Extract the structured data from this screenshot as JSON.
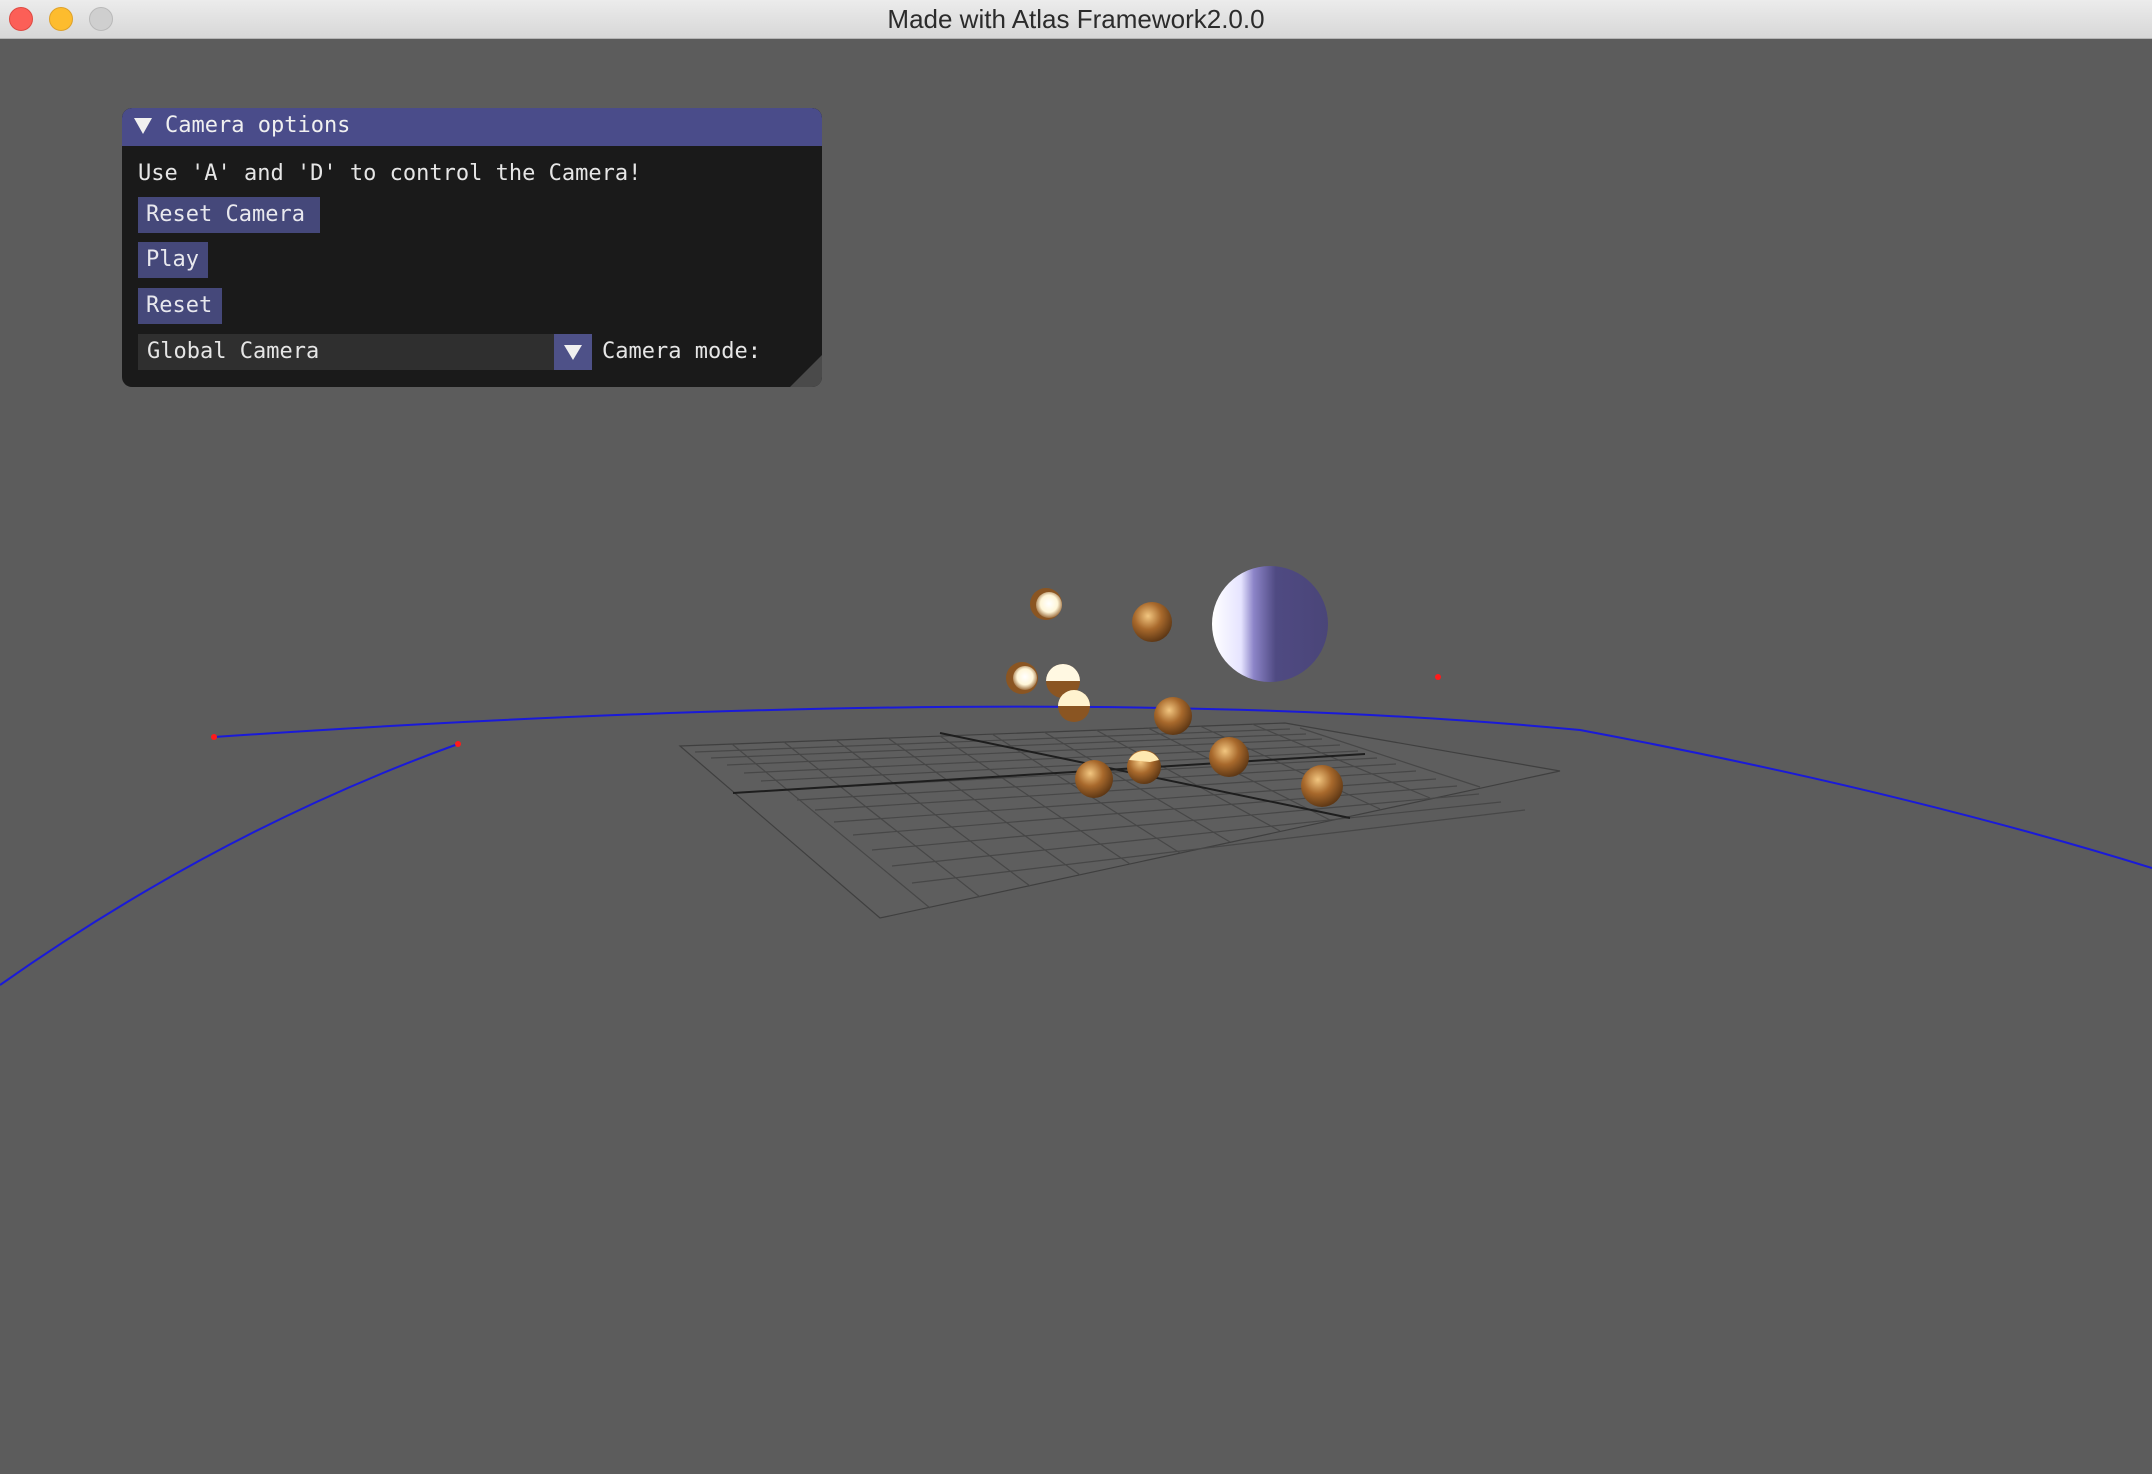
{
  "window": {
    "title": "Made with Atlas Framework2.0.0"
  },
  "panel": {
    "title": "Camera options",
    "hint": "Use 'A' and 'D' to control the Camera!",
    "buttons": {
      "reset_camera": "Reset Camera",
      "play": "Play",
      "reset": "Reset"
    },
    "camera_mode": {
      "selected": "Global Camera",
      "label": "Camera mode:"
    }
  },
  "colors": {
    "background": "#5c5c5c",
    "panel_header": "#4a4c8a",
    "button": "#45487a",
    "curve": "#1a1ad8",
    "control_point": "#ff1a1a",
    "sphere_bronze": "#8a5522",
    "sphere_purple": "#4e4a80"
  }
}
